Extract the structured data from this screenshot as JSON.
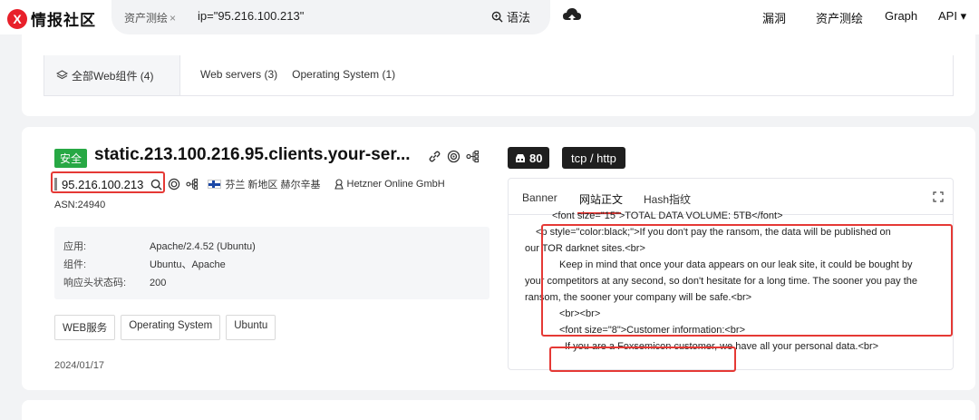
{
  "header": {
    "logo_mark": "X",
    "logo_text": "情报社区",
    "search_tab": "资产测绘",
    "search_tab_close": "×",
    "search_query": "ip=\"95.216.100.213\"",
    "syntax_label": "语法",
    "nav": [
      "漏洞",
      "资产测绘",
      "Graph",
      "API ▾"
    ]
  },
  "components": {
    "head_label": "全部Web组件 (4)",
    "items": [
      "Web servers (3)",
      "Operating System (1)"
    ]
  },
  "host": {
    "safe_label": "安全",
    "title": "static.213.100.216.95.clients.your-ser...",
    "ip": "95.216.100.213",
    "location": "芬兰 新地区 赫尔辛基",
    "org": "Hetzner Online GmbH",
    "asn": "ASN:24940",
    "info": [
      {
        "k": "应用:",
        "v": "Apache/2.4.52 (Ubuntu)"
      },
      {
        "k": "组件:",
        "v": "Ubuntu、Apache"
      },
      {
        "k": "响应头状态码:",
        "v": "200"
      }
    ],
    "tags": [
      "WEB服务",
      "Operating System",
      "Ubuntu"
    ],
    "date": "2024/01/17"
  },
  "service": {
    "port": "80",
    "protocol": "tcp / http",
    "tabs": [
      "Banner",
      "网站正文",
      "Hash指纹"
    ],
    "active_tab": "网站正文",
    "code_lines": [
      "<font size=\"15\">TOTAL DATA VOLUME: 5TB</font>",
      "<p style=\"color:black;\">If you don't pay the ransom, the data will be published on",
      "our TOR darknet sites.<br>",
      "Keep in mind that once your data appears on our leak site, it could be bought by",
      "your competitors at any second, so don't hesitate for a long time. The sooner you pay the",
      "ransom, the sooner your company will be safe.<br>",
      "<br><br>",
      "<font size=\"8\">Customer information:<br>",
      "If you are a Foxsemicon customer, we have all your personal data.<br>"
    ]
  },
  "colors": {
    "accent_red": "#e53935",
    "safe_green": "#27a844",
    "badge_dark": "#1f1f1f"
  }
}
